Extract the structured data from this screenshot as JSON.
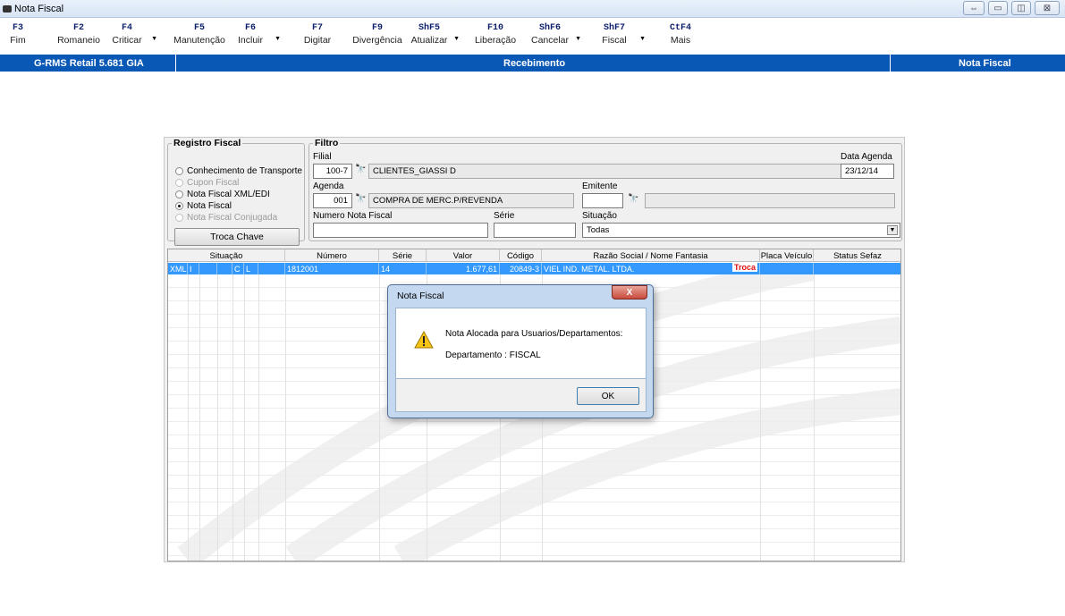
{
  "window": {
    "title": "Nota Fiscal",
    "controls": {
      "restore": "⇔",
      "minimize": "▭",
      "maximize": "◫",
      "close": "⊠"
    }
  },
  "toolbar": {
    "keys": [
      {
        "key": "F3",
        "label": "Fim"
      },
      {
        "key": "F2",
        "label": "Romaneio"
      },
      {
        "key": "F4",
        "label": "Criticar"
      },
      {
        "key": "F5",
        "label": "Manutenção"
      },
      {
        "key": "F6",
        "label": "Incluir"
      },
      {
        "key": "F7",
        "label": "Digitar"
      },
      {
        "key": "F9",
        "label": "Divergência"
      },
      {
        "key": "ShF5",
        "label": "Atualizar"
      },
      {
        "key": "F10",
        "label": "Liberação"
      },
      {
        "key": "ShF6",
        "label": "Cancelar"
      },
      {
        "key": "ShF7",
        "label": "Fiscal"
      },
      {
        "key": "CtF4",
        "label": "Mais"
      }
    ],
    "drop_glyph": "▼"
  },
  "statusbar": {
    "app": "G-RMS Retail 5.681 GIA",
    "module": "Recebimento",
    "screen": "Nota Fiscal"
  },
  "registro": {
    "legend": "Registro Fiscal",
    "options": [
      "Conhecimento de Transporte",
      "Cupon Fiscal",
      "Nota Fiscal XML/EDI",
      "Nota Fiscal",
      "Nota Fiscal Conjugada"
    ],
    "selected_index": 3,
    "troca_button": "Troca Chave"
  },
  "filtro": {
    "legend": "Filtro",
    "filial_label": "Filial",
    "filial_code": "100-7",
    "filial_name": "CLIENTES_GIASSI D",
    "data_agenda_label": "Data Agenda",
    "data_agenda": "23/12/14",
    "agenda_label": "Agenda",
    "agenda_code": "001",
    "agenda_desc": "COMPRA DE MERC.P/REVENDA",
    "emitente_label": "Emitente",
    "emitente_code": "",
    "emitente_name": "",
    "numero_label": "Numero Nota Fiscal",
    "numero_value": "",
    "serie_label": "Série",
    "serie_value": "",
    "situacao_label": "Situação",
    "situacao_value": "Todas",
    "binoculars": "🔭"
  },
  "grid": {
    "headers": [
      "Situação",
      "Número",
      "Série",
      "Valor",
      "Código",
      "Razão Social / Nome Fantasia",
      "Placa Veículo",
      "Status Sefaz"
    ],
    "row": {
      "sit": [
        "XML",
        "I",
        "",
        "",
        "C",
        "L"
      ],
      "numero": "1812001",
      "serie": "14",
      "valor": "1.677,61",
      "codigo": "20849-3",
      "razao": "VIEL IND. METAL. LTDA.",
      "troca": "Troca",
      "placa": "",
      "status": ""
    }
  },
  "dialog": {
    "title": "Nota Fiscal",
    "close": "X",
    "message1": "Nota Alocada para Usuarios/Departamentos:",
    "message2": "Departamento : FISCAL",
    "ok": "OK"
  }
}
